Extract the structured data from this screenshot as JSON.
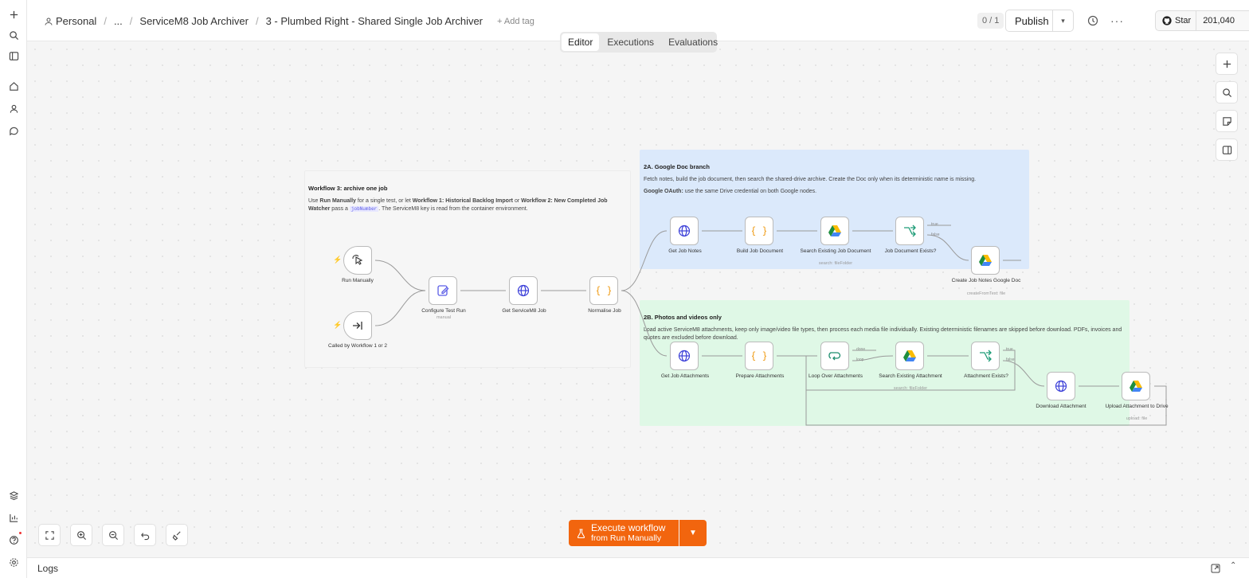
{
  "breadcrumb": {
    "project": "Personal",
    "ellipsis": "...",
    "folder": "ServiceM8 Job Archiver",
    "workflow": "3 - Plumbed Right - Shared Single Job Archiver",
    "add_tag": "+ Add tag"
  },
  "header": {
    "counter": "0 / 1",
    "publish": "Publish",
    "github_star": "Star",
    "github_count": "201,040"
  },
  "tabs": [
    {
      "label": "Editor",
      "active": true
    },
    {
      "label": "Executions",
      "active": false
    },
    {
      "label": "Evaluations",
      "active": false
    }
  ],
  "stickies": {
    "main": {
      "title": "Workflow 3: archive one job",
      "text_1": "Use ",
      "bold_1": "Run Manually",
      "text_2": " for a single test, or let ",
      "bold_2": "Workflow 1: Historical Backlog Import",
      "text_3": " or ",
      "bold_3": "Workflow 2: New Completed Job Watcher",
      "text_4": " pass a ",
      "code": "jobNumber",
      "text_5": ". The ServiceM8 key is read from the container environment."
    },
    "doc_branch": {
      "title": "2A. Google Doc branch",
      "line1": "Fetch notes, build the job document, then search the shared-drive archive. Create the Doc only when its deterministic name is missing.",
      "line2_bold": "Google OAuth:",
      "line2": " use the same Drive credential on both Google nodes."
    },
    "media_branch": {
      "title": "2B. Photos and videos only",
      "line1": "Load active ServiceM8 attachments, keep only image/video file types, then process each media file individually. Existing deterministic filenames are skipped before download. PDFs, invoices and quotes are excluded before download."
    }
  },
  "nodes": {
    "run_manually": {
      "label": "Run Manually"
    },
    "called_by": {
      "label": "Called by Workflow 1 or 2"
    },
    "configure": {
      "label": "Configure Test Run",
      "sub": "manual"
    },
    "get_job": {
      "label": "Get ServiceM8 Job"
    },
    "normalise": {
      "label": "Normalise Job"
    },
    "get_notes": {
      "label": "Get Job Notes"
    },
    "build_doc": {
      "label": "Build Job Document"
    },
    "search_doc": {
      "label": "Search Existing Job Document",
      "sub": "search: fileFolder"
    },
    "doc_exists": {
      "label": "Job Document Exists?",
      "true_label": "true",
      "false_label": "false"
    },
    "create_doc": {
      "label": "Create Job Notes Google Doc",
      "sub": "createFromText: file"
    },
    "get_attach": {
      "label": "Get Job Attachments"
    },
    "prep_attach": {
      "label": "Prepare Attachments"
    },
    "loop": {
      "label": "Loop Over Attachments",
      "done_label": "done",
      "loop_label": "loop"
    },
    "search_attach": {
      "label": "Search Existing Attachment",
      "sub": "search: fileFolder"
    },
    "attach_exists": {
      "label": "Attachment Exists?",
      "true_label": "true",
      "false_label": "false"
    },
    "download": {
      "label": "Download Attachment"
    },
    "upload": {
      "label": "Upload Attachment to Drive",
      "sub": "upload: file"
    }
  },
  "execute": {
    "line1": "Execute workflow",
    "line2": "from Run Manually"
  },
  "logs": {
    "label": "Logs"
  },
  "colors": {
    "accent": "#f2650e",
    "doc_branch_bg": "#dbe9fb",
    "media_branch_bg": "#dff8e6",
    "http_icon": "#3b3fd8",
    "code_icon": "#f0a020",
    "if_icon": "#1e9c77",
    "edit_icon": "#5b5de6"
  }
}
